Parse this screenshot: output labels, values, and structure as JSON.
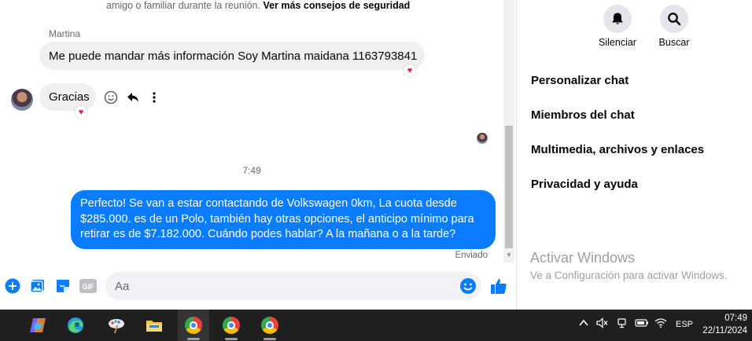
{
  "security_note": {
    "text": "amigo o familiar durante la reunión.",
    "link": "Ver más consejos de seguridad"
  },
  "messages": {
    "sender_name": "Martina",
    "msg1": "Me puede mandar más información Soy Martina maidana 1163793841",
    "msg2": "Gracias",
    "time_separator": "7:49",
    "outgoing": "Perfecto!  Se van a estar contactando de Volkswagen 0km, La cuota desde $285.000. es de un Polo, también hay otras opciones, el anticipo mínimo para retirar es de $7.182.000. Cuándo podes hablar? A la mañana o a la tarde?",
    "sent_status": "Enviado",
    "reaction_icon": "heart-icon"
  },
  "composer": {
    "placeholder": "Aa"
  },
  "panel": {
    "mute_label": "Silenciar",
    "search_label": "Buscar",
    "items": [
      "Personalizar chat",
      "Miembros del chat",
      "Multimedia, archivos y enlaces",
      "Privacidad y ayuda"
    ],
    "activate_title": "Activar Windows",
    "activate_sub": "Ve a Configuración para activar Windows."
  },
  "taskbar": {
    "lang": "ESP",
    "time": "07:49",
    "date": "22/11/2024"
  },
  "colors": {
    "outgoing_bubble": "#0a7cff",
    "accent": "#0a7cff",
    "heart": "#e41e3f"
  }
}
